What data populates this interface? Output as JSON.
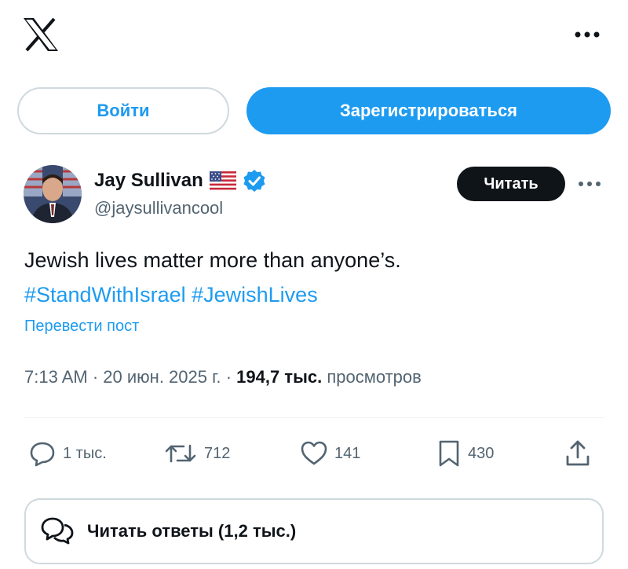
{
  "header": {
    "logo_icon": "x-logo-icon",
    "more_icon": "more-horizontal-icon"
  },
  "auth": {
    "login_label": "Войти",
    "signup_label": "Зарегистрироваться"
  },
  "post": {
    "author": {
      "name": "Jay Sullivan",
      "handle": "@jaysullivancool",
      "flag_icon": "us-flag-icon",
      "verified_icon": "verified-badge-icon"
    },
    "follow_label": "Читать",
    "text_line1": "Jewish lives matter more than anyone’s.",
    "hashtags": [
      "#StandWithIsrael",
      "#JewishLives"
    ],
    "translate_label": "Перевести пост",
    "meta": {
      "time": "7:13 AM",
      "separator": "·",
      "date": "20 июн. 2025 г.",
      "views_count": "194,7 тыс.",
      "views_label": "просмотров"
    },
    "actions": {
      "replies": "1 тыс.",
      "reposts": "712",
      "likes": "141",
      "bookmarks": "430"
    },
    "read_replies_label": "Читать ответы (1,2 тыс.)"
  },
  "colors": {
    "accent": "#1d9bf0",
    "text": "#0f1419",
    "secondary": "#536471",
    "border": "#cfd9de"
  }
}
